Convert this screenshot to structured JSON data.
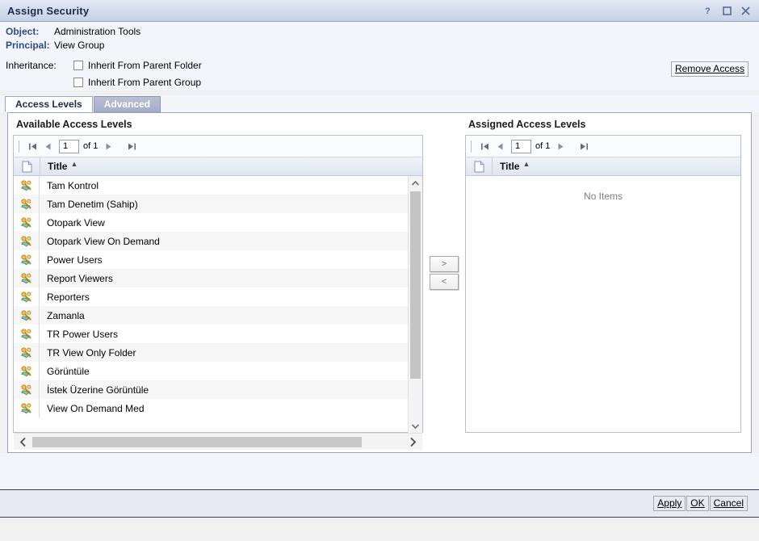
{
  "window": {
    "title": "Assign Security",
    "controls": [
      {
        "name": "help-icon",
        "glyph": "?"
      },
      {
        "name": "maximize-icon",
        "glyph": "□"
      },
      {
        "name": "close-icon",
        "glyph": "✕"
      }
    ]
  },
  "info": {
    "object_label": "Object:",
    "object_value": "Administration Tools",
    "principal_label": "Principal:",
    "principal_value": "View Group",
    "inheritance_label": "Inheritance:",
    "inherit_parent_folder": "Inherit From Parent Folder",
    "inherit_parent_folder_checked": false,
    "inherit_parent_group": "Inherit From Parent Group",
    "inherit_parent_group_checked": false,
    "remove_access": "Remove Access"
  },
  "tabs": [
    {
      "label": "Access Levels",
      "active": true
    },
    {
      "label": "Advanced",
      "active": false
    }
  ],
  "available": {
    "title": "Available Access Levels",
    "pager": {
      "page": "1",
      "of": "of 1"
    },
    "column_title": "Title",
    "sort": "asc",
    "rows": [
      {
        "title": "Tam Kontrol"
      },
      {
        "title": "Tam Denetim (Sahip)"
      },
      {
        "title": "Otopark View"
      },
      {
        "title": "Otopark View On Demand"
      },
      {
        "title": "Power Users"
      },
      {
        "title": "Report Viewers"
      },
      {
        "title": "Reporters"
      },
      {
        "title": "Zamanla"
      },
      {
        "title": "TR Power Users"
      },
      {
        "title": "TR View Only Folder"
      },
      {
        "title": "Görüntüle"
      },
      {
        "title": "İstek Üzerine Görüntüle"
      },
      {
        "title": "View On Demand Med"
      }
    ]
  },
  "transfer": {
    "add_label": ">",
    "remove_label": "<"
  },
  "assigned": {
    "title": "Assigned Access Levels",
    "pager": {
      "page": "1",
      "of": "of 1"
    },
    "column_title": "Title",
    "sort": "asc",
    "empty_text": "No Items",
    "rows": []
  },
  "footer": {
    "apply": "Apply",
    "ok": "OK",
    "cancel": "Cancel"
  },
  "colors": {
    "titlebar": "#d3dbec",
    "accent_blue": "#2b4b8c",
    "tab_active_text": "#1d2a4d",
    "header_gradient": "#dfe6f1",
    "footer_bg": "#e6eaf2"
  }
}
